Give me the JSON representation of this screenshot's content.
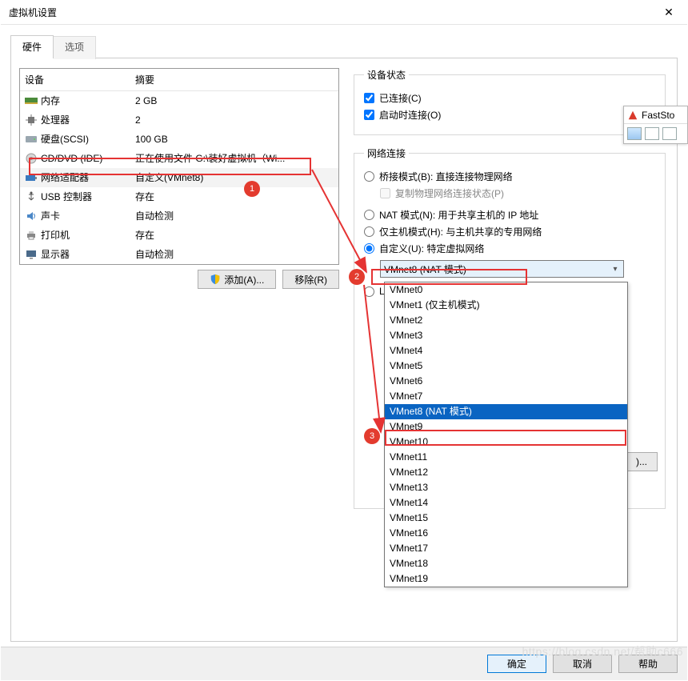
{
  "window": {
    "title": "虚拟机设置"
  },
  "tabs": {
    "hardware": "硬件",
    "options": "选项"
  },
  "device_table": {
    "col_device": "设备",
    "col_summary": "摘要",
    "rows": [
      {
        "name": "内存",
        "summary": "2 GB",
        "icon": "memory"
      },
      {
        "name": "处理器",
        "summary": "2",
        "icon": "cpu"
      },
      {
        "name": "硬盘(SCSI)",
        "summary": "100 GB",
        "icon": "hdd"
      },
      {
        "name": "CD/DVD (IDE)",
        "summary": "正在使用文件 G:\\装好虚拟机（Wi...",
        "icon": "cd"
      },
      {
        "name": "网络适配器",
        "summary": "自定义(VMnet8)",
        "icon": "nic"
      },
      {
        "name": "USB 控制器",
        "summary": "存在",
        "icon": "usb"
      },
      {
        "name": "声卡",
        "summary": "自动检测",
        "icon": "sound"
      },
      {
        "name": "打印机",
        "summary": "存在",
        "icon": "printer"
      },
      {
        "name": "显示器",
        "summary": "自动检测",
        "icon": "display"
      }
    ]
  },
  "buttons": {
    "add": "添加(A)...",
    "remove": "移除(R)"
  },
  "device_status": {
    "legend": "设备状态",
    "connected": "已连接(C)",
    "connect_power_on": "启动时连接(O)"
  },
  "network": {
    "legend": "网络连接",
    "bridged": "桥接模式(B): 直接连接物理网络",
    "replicate": "复制物理网络连接状态(P)",
    "nat": "NAT 模式(N): 用于共享主机的 IP 地址",
    "hostonly": "仅主机模式(H): 与主机共享的专用网络",
    "custom": "自定义(U): 特定虚拟网络",
    "lanseg_hidden": "L",
    "lan_btn": ")..."
  },
  "combo": {
    "selected": "VMnet8 (NAT 模式)",
    "options": [
      "VMnet0",
      "VMnet1 (仅主机模式)",
      "VMnet2",
      "VMnet3",
      "VMnet4",
      "VMnet5",
      "VMnet6",
      "VMnet7",
      "VMnet8 (NAT 模式)",
      "VMnet9",
      "VMnet10",
      "VMnet11",
      "VMnet12",
      "VMnet13",
      "VMnet14",
      "VMnet15",
      "VMnet16",
      "VMnet17",
      "VMnet18",
      "VMnet19"
    ],
    "highlight_index": 8
  },
  "footer": {
    "ok": "确定",
    "cancel": "取消",
    "help": "帮助"
  },
  "faststone": {
    "title": "FastSto"
  },
  "annotations": {
    "n1": "1",
    "n2": "2",
    "n3": "3"
  },
  "watermark": "https://blog.csdn.net/帮助c666"
}
